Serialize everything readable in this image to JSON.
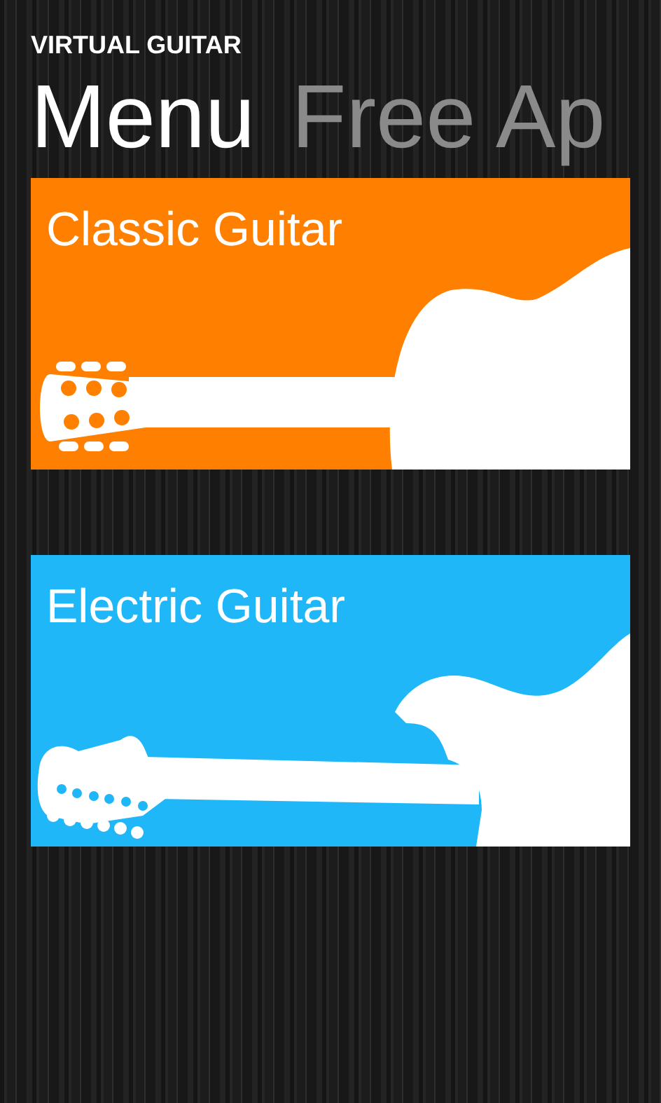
{
  "app_title": "VIRTUAL GUITAR",
  "pivot": [
    {
      "label": "Menu",
      "selected": true
    },
    {
      "label": "Free Ap",
      "selected": false
    }
  ],
  "tiles": [
    {
      "label": "Classic Guitar",
      "kind": "classic",
      "color": "#ff7f00"
    },
    {
      "label": "Electric Guitar",
      "kind": "electric",
      "color": "#1fb7f7"
    }
  ]
}
